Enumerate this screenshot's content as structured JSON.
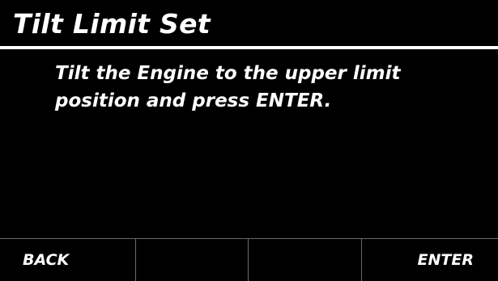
{
  "screen": {
    "title": "Tilt Limit Set",
    "message_lines": [
      "Tilt the Engine to the upper limit",
      "position and press ENTER."
    ]
  },
  "softkeys": {
    "key1": "BACK",
    "key2": "",
    "key3": "",
    "key4": "ENTER"
  },
  "colors": {
    "background": "#000000",
    "foreground": "#ffffff",
    "divider": "#6a6a6a"
  }
}
